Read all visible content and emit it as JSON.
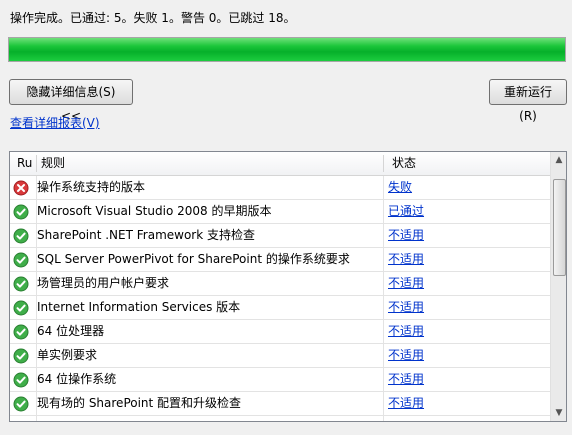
{
  "status_text": "操作完成。已通过: 5。失败 1。警告 0。已跳过 18。",
  "progress_percent": 100,
  "buttons": {
    "hide_details": "隐藏详细信息(S) <<",
    "rerun": "重新运行(R)"
  },
  "report_link": "查看详细报表(V)",
  "table": {
    "columns": {
      "ru": "Ru",
      "rule": "规则",
      "status": "状态"
    },
    "rows": [
      {
        "rule": "操作系统支持的版本",
        "status": "失败",
        "icon": "error-icon"
      },
      {
        "rule": "Microsoft Visual Studio 2008 的早期版本",
        "status": "已通过",
        "icon": "pass-icon"
      },
      {
        "rule": "SharePoint .NET Framework 支持检查",
        "status": "不适用",
        "icon": "pass-icon"
      },
      {
        "rule": "SQL Server PowerPivot for SharePoint 的操作系统要求",
        "status": "不适用",
        "icon": "pass-icon"
      },
      {
        "rule": "场管理员的用户帐户要求",
        "status": "不适用",
        "icon": "pass-icon"
      },
      {
        "rule": "Internet Information Services 版本",
        "status": "不适用",
        "icon": "pass-icon"
      },
      {
        "rule": "64 位处理器",
        "status": "不适用",
        "icon": "pass-icon"
      },
      {
        "rule": "单实例要求",
        "status": "不适用",
        "icon": "pass-icon"
      },
      {
        "rule": "64 位操作系统",
        "status": "不适用",
        "icon": "pass-icon"
      },
      {
        "rule": "现有场的 SharePoint 配置和升级检查",
        "status": "不适用",
        "icon": "pass-icon"
      }
    ]
  },
  "colors": {
    "progress_green": "#06b02a",
    "link_blue": "#0033cc",
    "error_red": "#d9393b",
    "pass_green": "#3fae49"
  }
}
